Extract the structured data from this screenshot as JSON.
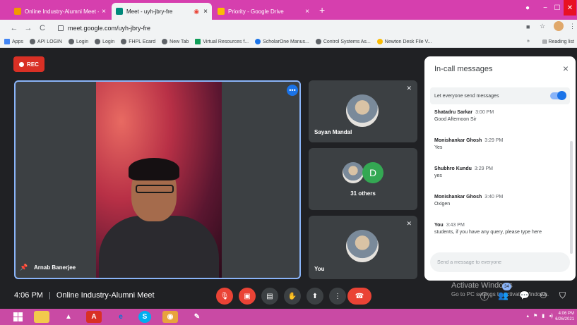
{
  "browser": {
    "tabs": [
      {
        "title": "Online Industry-Alumni Meet - ..",
        "close": "×",
        "active": false,
        "color": "#f29900"
      },
      {
        "title": "Meet - uyh-jbry-fre",
        "close": "×",
        "active": true,
        "color": "#00897b"
      },
      {
        "title": "Priority - Google Drive",
        "close": "×",
        "active": false,
        "color": "#fbbc04"
      }
    ],
    "new_tab": "+",
    "window_controls": {
      "minimize": "−",
      "maximize": "☐",
      "close": "✕"
    },
    "nav": {
      "back": "←",
      "forward": "→",
      "reload": "C"
    },
    "url": "meet.google.com/uyh-jbry-fre",
    "bookmarks": [
      "Apps",
      "API LOGIN",
      "Login",
      "Login",
      "FHPL Ecard",
      "New Tab",
      "Virtual Resources f...",
      "ScholarOne Manus...",
      "Control Systems As...",
      "Newton Desk File V..."
    ],
    "bookmarks_overflow": "»",
    "reading_list": "Reading list"
  },
  "meet": {
    "rec_label": "REC",
    "main_participant": "Arnab Banerjee",
    "participants": [
      {
        "name": "Sayan Mandal"
      },
      {
        "label": "31 others",
        "avatar_letter": "D"
      },
      {
        "name": "You"
      }
    ],
    "meeting_time": "4:06 PM",
    "meeting_separator": "|",
    "meeting_title": "Online Industry-Alumni Meet",
    "participant_count_badge": "34"
  },
  "chat": {
    "title": "In-call messages",
    "close": "×",
    "toggle_label": "Let everyone send messages",
    "toggle_on": true,
    "messages": [
      {
        "sender": "Shatadru Sarkar",
        "time": "3:00 PM",
        "text": "Good Afternoon Sir"
      },
      {
        "sender": "Monishankar Ghosh",
        "time": "3:29 PM",
        "text": "Yes"
      },
      {
        "sender": "Shubhro Kundu",
        "time": "3:29 PM",
        "text": "yes"
      },
      {
        "sender": "Monishankar Ghosh",
        "time": "3:40 PM",
        "text": "Oxigen"
      },
      {
        "sender": "You",
        "time": "3:43 PM",
        "text": "students, if you have any query, please type here"
      }
    ],
    "input_placeholder": "Send a message to everyone"
  },
  "watermark": {
    "line1": "Activate Windows",
    "line2": "Go to PC settings to activate Windows."
  },
  "taskbar": {
    "tray_time": "4:06 PM",
    "tray_date": "6/26/2021"
  },
  "colors": {
    "accent": "#1a73e8",
    "rec": "#d93025",
    "leave": "#ea4335",
    "tabbar": "#d63fae",
    "taskbar": "#c94aa4"
  }
}
